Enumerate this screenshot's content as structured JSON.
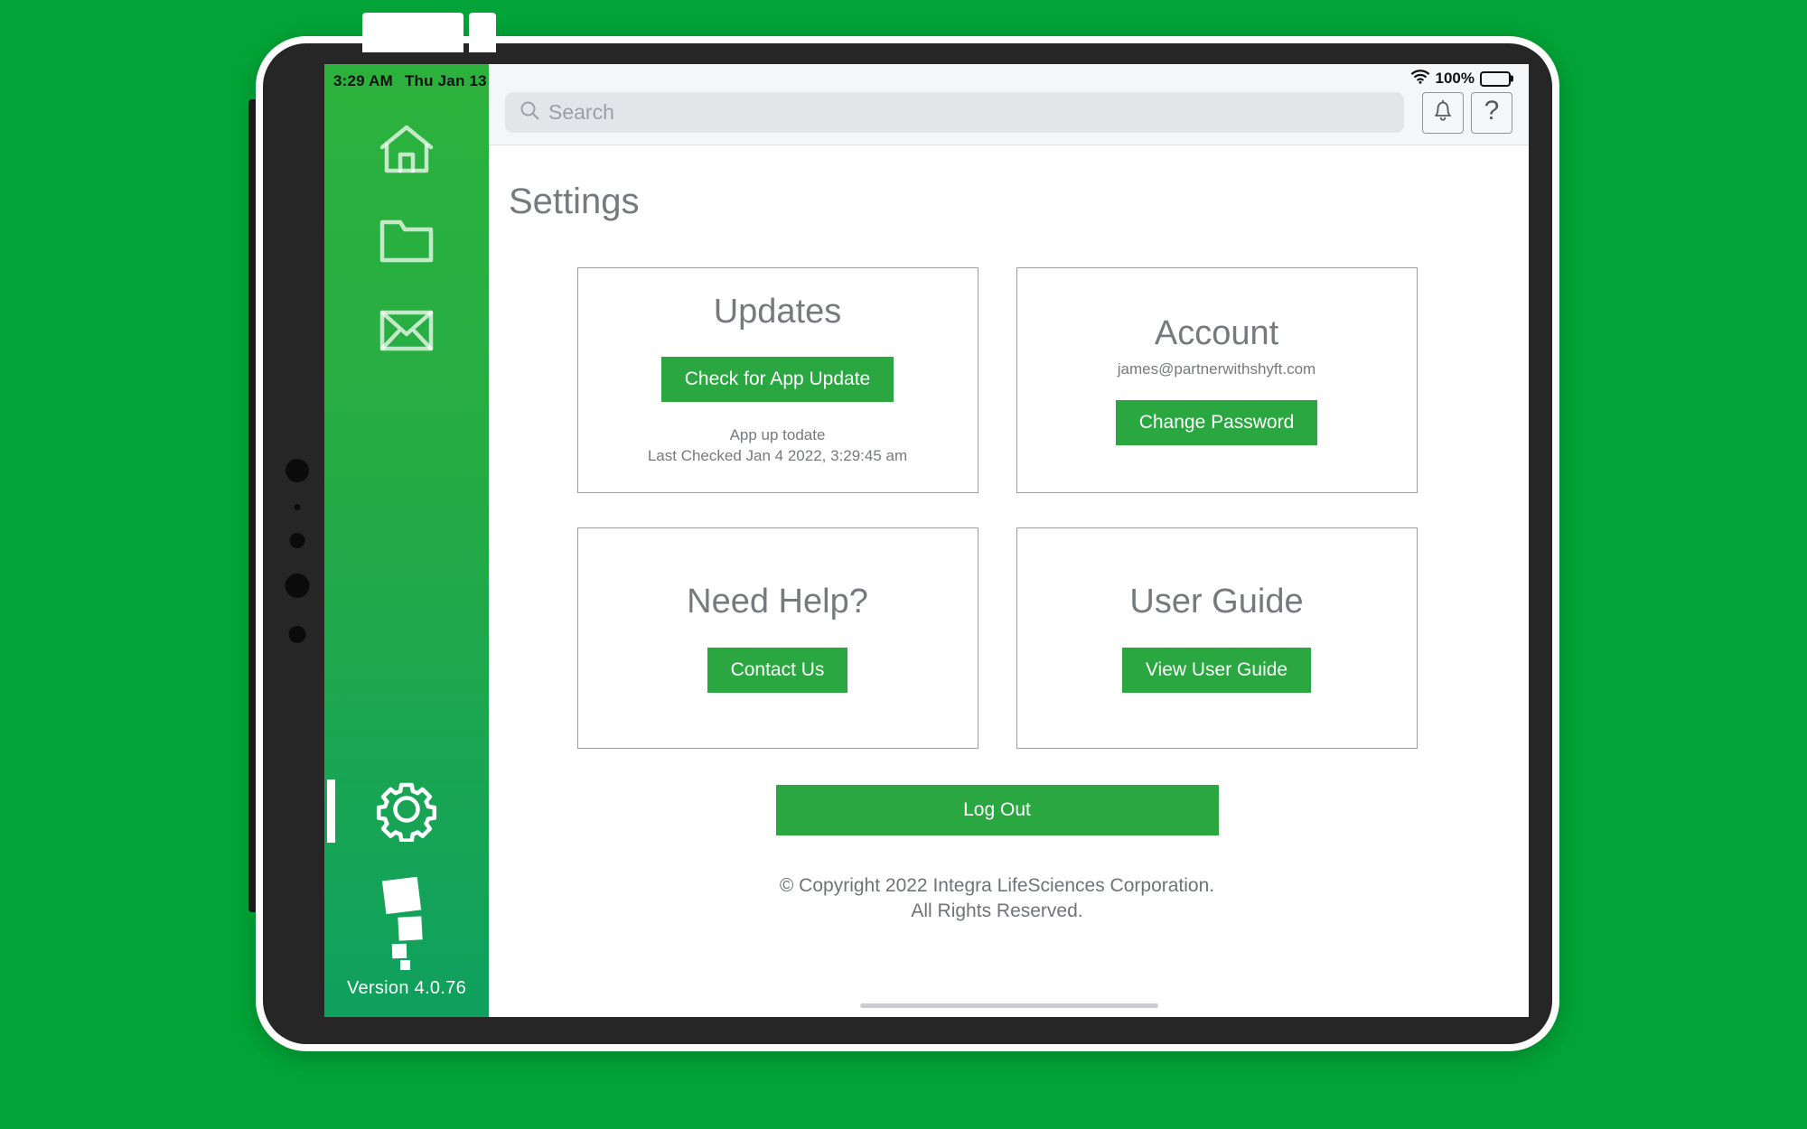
{
  "theme": {
    "background_green": "#02a437",
    "sidebar_green_top": "#2cb23c",
    "sidebar_green_bottom": "#0fa05e",
    "button_green": "#2ba741",
    "text_gray": "#76797d",
    "card_border": "#9a9da1"
  },
  "status_bar": {
    "time": "3:29 AM",
    "date": "Thu Jan 13",
    "wifi_icon": "wifi-icon",
    "battery_percent": "100%",
    "battery_icon": "battery-full-icon"
  },
  "sidebar": {
    "items": [
      {
        "icon": "home-icon",
        "label": "Home"
      },
      {
        "icon": "folder-icon",
        "label": "Files"
      },
      {
        "icon": "mail-icon",
        "label": "Messages"
      },
      {
        "icon": "gear-icon",
        "label": "Settings",
        "active": true
      }
    ],
    "brand_logo_icon": "integra-logo-icon",
    "version": "Version 4.0.76"
  },
  "topbar": {
    "search": {
      "icon": "search-icon",
      "placeholder": "Search",
      "value": ""
    },
    "notifications_icon": "bell-icon",
    "help_icon": "question-mark-icon"
  },
  "page": {
    "title": "Settings",
    "cards": [
      {
        "name": "updates",
        "title": "Updates",
        "button": "Check for App Update",
        "status": "App up todate",
        "last_checked": "Last Checked Jan 4 2022, 3:29:45 am"
      },
      {
        "name": "account",
        "title": "Account",
        "email": "james@partnerwithshyft.com",
        "button": "Change Password"
      },
      {
        "name": "need-help",
        "title": "Need Help?",
        "button": "Contact Us"
      },
      {
        "name": "user-guide",
        "title": "User Guide",
        "button": "View User Guide"
      }
    ],
    "logout_button": "Log Out",
    "copyright_line1": "© Copyright 2022 Integra LifeSciences Corporation.",
    "copyright_line2": "All Rights Reserved."
  }
}
